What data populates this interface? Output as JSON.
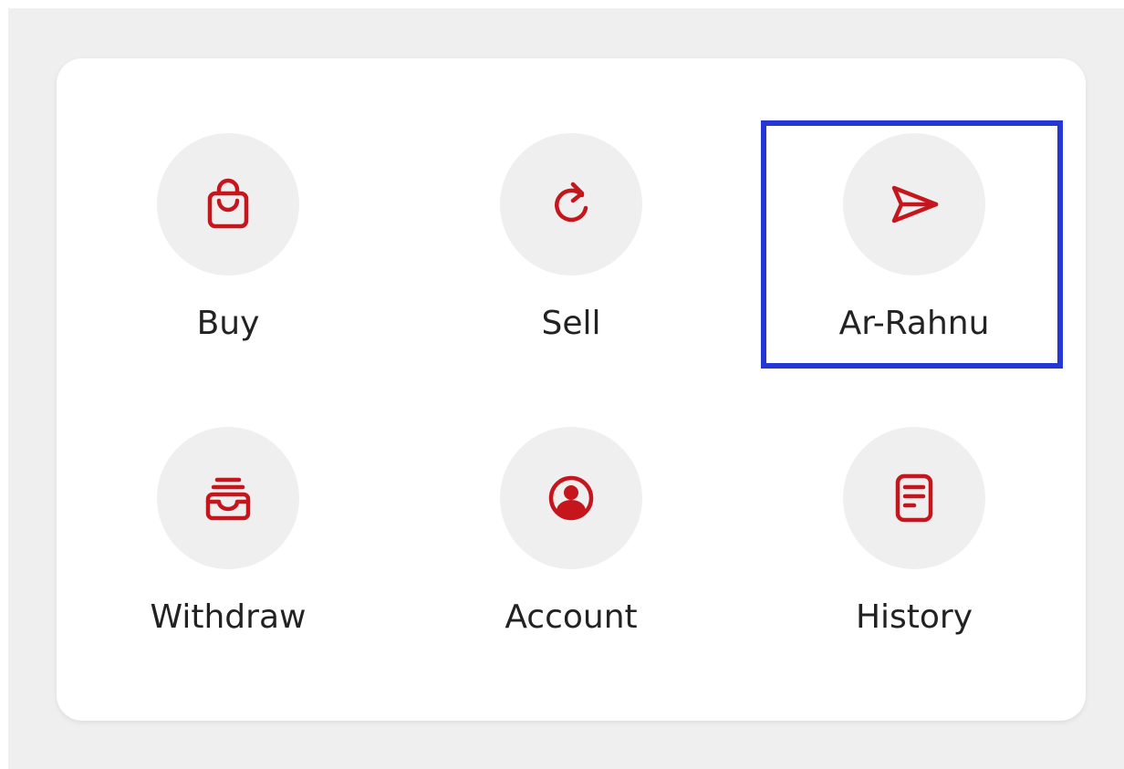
{
  "theme": {
    "accent": "#c4161c",
    "icon_bg": "#efefef",
    "page_bg": "#efefef",
    "card_bg": "#ffffff",
    "highlight": "#2436d6"
  },
  "menu": {
    "items": [
      {
        "label": "Buy",
        "icon": "shopping-bag-icon"
      },
      {
        "label": "Sell",
        "icon": "refresh-icon"
      },
      {
        "label": "Ar-Rahnu",
        "icon": "send-icon"
      },
      {
        "label": "Withdraw",
        "icon": "inbox-icon"
      },
      {
        "label": "Account",
        "icon": "user-circle-icon"
      },
      {
        "label": "History",
        "icon": "document-icon"
      }
    ],
    "highlighted_item": "Ar-Rahnu"
  }
}
